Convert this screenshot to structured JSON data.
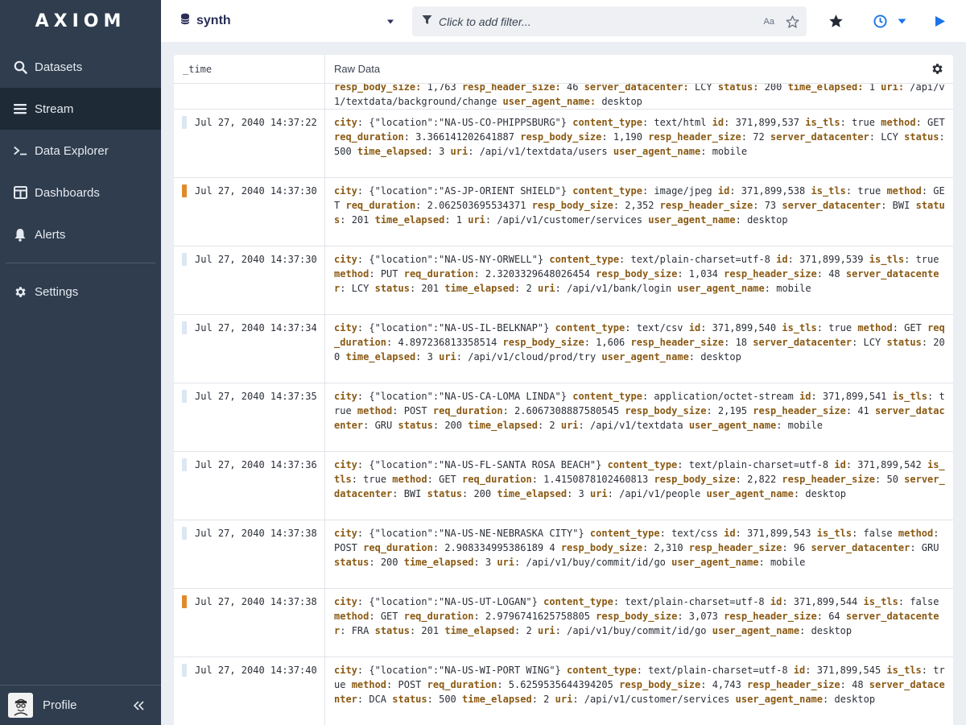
{
  "app": {
    "logo": "AXIOM"
  },
  "sidebar": {
    "items": [
      {
        "label": "Datasets",
        "icon": "search-icon"
      },
      {
        "label": "Stream",
        "icon": "stream-icon",
        "active": true
      },
      {
        "label": "Data Explorer",
        "icon": "terminal-icon"
      },
      {
        "label": "Dashboards",
        "icon": "dashboard-icon"
      },
      {
        "label": "Alerts",
        "icon": "bell-icon"
      }
    ],
    "settings": {
      "label": "Settings",
      "icon": "gear-icon"
    },
    "profile": {
      "label": "Profile"
    }
  },
  "topbar": {
    "dataset": "synth",
    "filter_placeholder": "Click to add filter...",
    "case_label": "Aa"
  },
  "table": {
    "columns": {
      "time": "_time",
      "raw": "Raw Data"
    },
    "partial_row": {
      "html": "<span class=\"k\">resp_body_size:</span> 1,763 <span class=\"k\">resp_header_size:</span> 46 <span class=\"k\">server_datacenter:</span> LCY <span class=\"k\">status:</span> 200 <span class=\"k\">time_elapsed:</span> 1 <span class=\"k\">uri:</span> /api/v1/textdata/background/change <span class=\"k\">user_agent_name:</span> desktop"
    },
    "rows": [
      {
        "time": "Jul 27, 2040 14:37:22",
        "level": "info",
        "fields": [
          [
            "city",
            "{\"location\":\"NA-US-CO-PHIPPSBURG\"}"
          ],
          [
            "content_type",
            "text/html"
          ],
          [
            "id",
            "371,899,537"
          ],
          [
            "is_tls",
            "true"
          ],
          [
            "method",
            "GET"
          ],
          [
            "req_duration",
            "3.366141202641887"
          ],
          [
            "resp_body_size",
            "1,190"
          ],
          [
            "resp_header_size",
            "72"
          ],
          [
            "server_datacenter",
            "LCY"
          ],
          [
            "status",
            "500"
          ],
          [
            "time_elapsed",
            "3"
          ],
          [
            "uri",
            "/api/v1/textdata/users"
          ],
          [
            "user_agent_name",
            "mobile"
          ]
        ]
      },
      {
        "time": "Jul 27, 2040 14:37:30",
        "level": "warn",
        "fields": [
          [
            "city",
            "{\"location\":\"AS-JP-ORIENT SHIELD\"}"
          ],
          [
            "content_type",
            "image/jpeg"
          ],
          [
            "id",
            "371,899,538"
          ],
          [
            "is_tls",
            "true"
          ],
          [
            "method",
            "GET"
          ],
          [
            "req_duration",
            "2.062503695534371"
          ],
          [
            "resp_body_size",
            "2,352"
          ],
          [
            "resp_header_size",
            "73"
          ],
          [
            "server_datacenter",
            "BWI"
          ],
          [
            "status",
            "201"
          ],
          [
            "time_elapsed",
            "1"
          ],
          [
            "uri",
            "/api/v1/customer/services"
          ],
          [
            "user_agent_name",
            "desktop"
          ]
        ]
      },
      {
        "time": "Jul 27, 2040 14:37:30",
        "level": "info",
        "fields": [
          [
            "city",
            "{\"location\":\"NA-US-NY-ORWELL\"}"
          ],
          [
            "content_type",
            "text/plain-charset=utf-8"
          ],
          [
            "id",
            "371,899,539"
          ],
          [
            "is_tls",
            "true"
          ],
          [
            "method",
            "PUT"
          ],
          [
            "req_duration",
            "2.3203329648026454"
          ],
          [
            "resp_body_size",
            "1,034"
          ],
          [
            "resp_header_size",
            "48"
          ],
          [
            "server_datacenter",
            "LCY"
          ],
          [
            "status",
            "201"
          ],
          [
            "time_elapsed",
            "2"
          ],
          [
            "uri",
            "/api/v1/bank/login"
          ],
          [
            "user_agent_name",
            "mobile"
          ]
        ]
      },
      {
        "time": "Jul 27, 2040 14:37:34",
        "level": "info",
        "fields": [
          [
            "city",
            "{\"location\":\"NA-US-IL-BELKNAP\"}"
          ],
          [
            "content_type",
            "text/csv"
          ],
          [
            "id",
            "371,899,540"
          ],
          [
            "is_tls",
            "true"
          ],
          [
            "method",
            "GET"
          ],
          [
            "req_duration",
            "4.897236813358514"
          ],
          [
            "resp_body_size",
            "1,606"
          ],
          [
            "resp_header_size",
            "18"
          ],
          [
            "server_datacenter",
            "LCY"
          ],
          [
            "status",
            "200"
          ],
          [
            "time_elapsed",
            "3"
          ],
          [
            "uri",
            "/api/v1/cloud/prod/try"
          ],
          [
            "user_agent_name",
            "desktop"
          ]
        ]
      },
      {
        "time": "Jul 27, 2040 14:37:35",
        "level": "info",
        "fields": [
          [
            "city",
            "{\"location\":\"NA-US-CA-LOMA LINDA\"}"
          ],
          [
            "content_type",
            "application/octet-stream"
          ],
          [
            "id",
            "371,899,541"
          ],
          [
            "is_tls",
            "true"
          ],
          [
            "method",
            "POST"
          ],
          [
            "req_duration",
            "2.6067308887580545"
          ],
          [
            "resp_body_size",
            "2,195"
          ],
          [
            "resp_header_size",
            "41"
          ],
          [
            "server_datacenter",
            "GRU"
          ],
          [
            "status",
            "200"
          ],
          [
            "time_elapsed",
            "2"
          ],
          [
            "uri",
            "/api/v1/textdata"
          ],
          [
            "user_agent_name",
            "mobile"
          ]
        ]
      },
      {
        "time": "Jul 27, 2040 14:37:36",
        "level": "info",
        "fields": [
          [
            "city",
            "{\"location\":\"NA-US-FL-SANTA ROSA BEACH\"}"
          ],
          [
            "content_type",
            "text/plain-charset=utf-8"
          ],
          [
            "id",
            "371,899,542"
          ],
          [
            "is_tls",
            "true"
          ],
          [
            "method",
            "GET"
          ],
          [
            "req_duration",
            "1.4150878102460813"
          ],
          [
            "resp_body_size",
            "2,822"
          ],
          [
            "resp_header_size",
            "50"
          ],
          [
            "server_datacenter",
            "BWI"
          ],
          [
            "status",
            "200"
          ],
          [
            "time_elapsed",
            "3"
          ],
          [
            "uri",
            "/api/v1/people"
          ],
          [
            "user_agent_name",
            "desktop"
          ]
        ]
      },
      {
        "time": "Jul 27, 2040 14:37:38",
        "level": "info",
        "fields": [
          [
            "city",
            "{\"location\":\"NA-US-NE-NEBRASKA CITY\"}"
          ],
          [
            "content_type",
            "text/css"
          ],
          [
            "id",
            "371,899,543"
          ],
          [
            "is_tls",
            "false"
          ],
          [
            "method",
            "POST"
          ],
          [
            "req_duration",
            "2.908334995386189 4"
          ],
          [
            "resp_body_size",
            "2,310"
          ],
          [
            "resp_header_size",
            "96"
          ],
          [
            "server_datacenter",
            "GRU"
          ],
          [
            "status",
            "200"
          ],
          [
            "time_elapsed",
            "3"
          ],
          [
            "uri",
            "/api/v1/buy/commit/id/go"
          ],
          [
            "user_agent_name",
            "mobile"
          ]
        ]
      },
      {
        "time": "Jul 27, 2040 14:37:38",
        "level": "warn",
        "fields": [
          [
            "city",
            "{\"location\":\"NA-US-UT-LOGAN\"}"
          ],
          [
            "content_type",
            "text/plain-charset=utf-8"
          ],
          [
            "id",
            "371,899,544"
          ],
          [
            "is_tls",
            "false"
          ],
          [
            "method",
            "GET"
          ],
          [
            "req_duration",
            "2.9796741625758805"
          ],
          [
            "resp_body_size",
            "3,073"
          ],
          [
            "resp_header_size",
            "64"
          ],
          [
            "server_datacenter",
            "FRA"
          ],
          [
            "status",
            "201"
          ],
          [
            "time_elapsed",
            "2"
          ],
          [
            "uri",
            "/api/v1/buy/commit/id/go"
          ],
          [
            "user_agent_name",
            "desktop"
          ]
        ]
      },
      {
        "time": "Jul 27, 2040 14:37:40",
        "level": "info",
        "fields": [
          [
            "city",
            "{\"location\":\"NA-US-WI-PORT WING\"}"
          ],
          [
            "content_type",
            "text/plain-charset=utf-8"
          ],
          [
            "id",
            "371,899,545"
          ],
          [
            "is_tls",
            "true"
          ],
          [
            "method",
            "POST"
          ],
          [
            "req_duration",
            "5.6259535644394205"
          ],
          [
            "resp_body_size",
            "4,743"
          ],
          [
            "resp_header_size",
            "48"
          ],
          [
            "server_datacenter",
            "DCA"
          ],
          [
            "status",
            "500"
          ],
          [
            "time_elapsed",
            "2"
          ],
          [
            "uri",
            "/api/v1/customer/services"
          ],
          [
            "user_agent_name",
            "desktop"
          ]
        ]
      }
    ]
  },
  "colors": {
    "sidebar": "#2f3d4e",
    "sidebar_active": "#1f2a37",
    "accent": "#1a73e8",
    "key": "#8a5a14",
    "warn": "#e08a2e",
    "info": "#dbe7f3"
  }
}
